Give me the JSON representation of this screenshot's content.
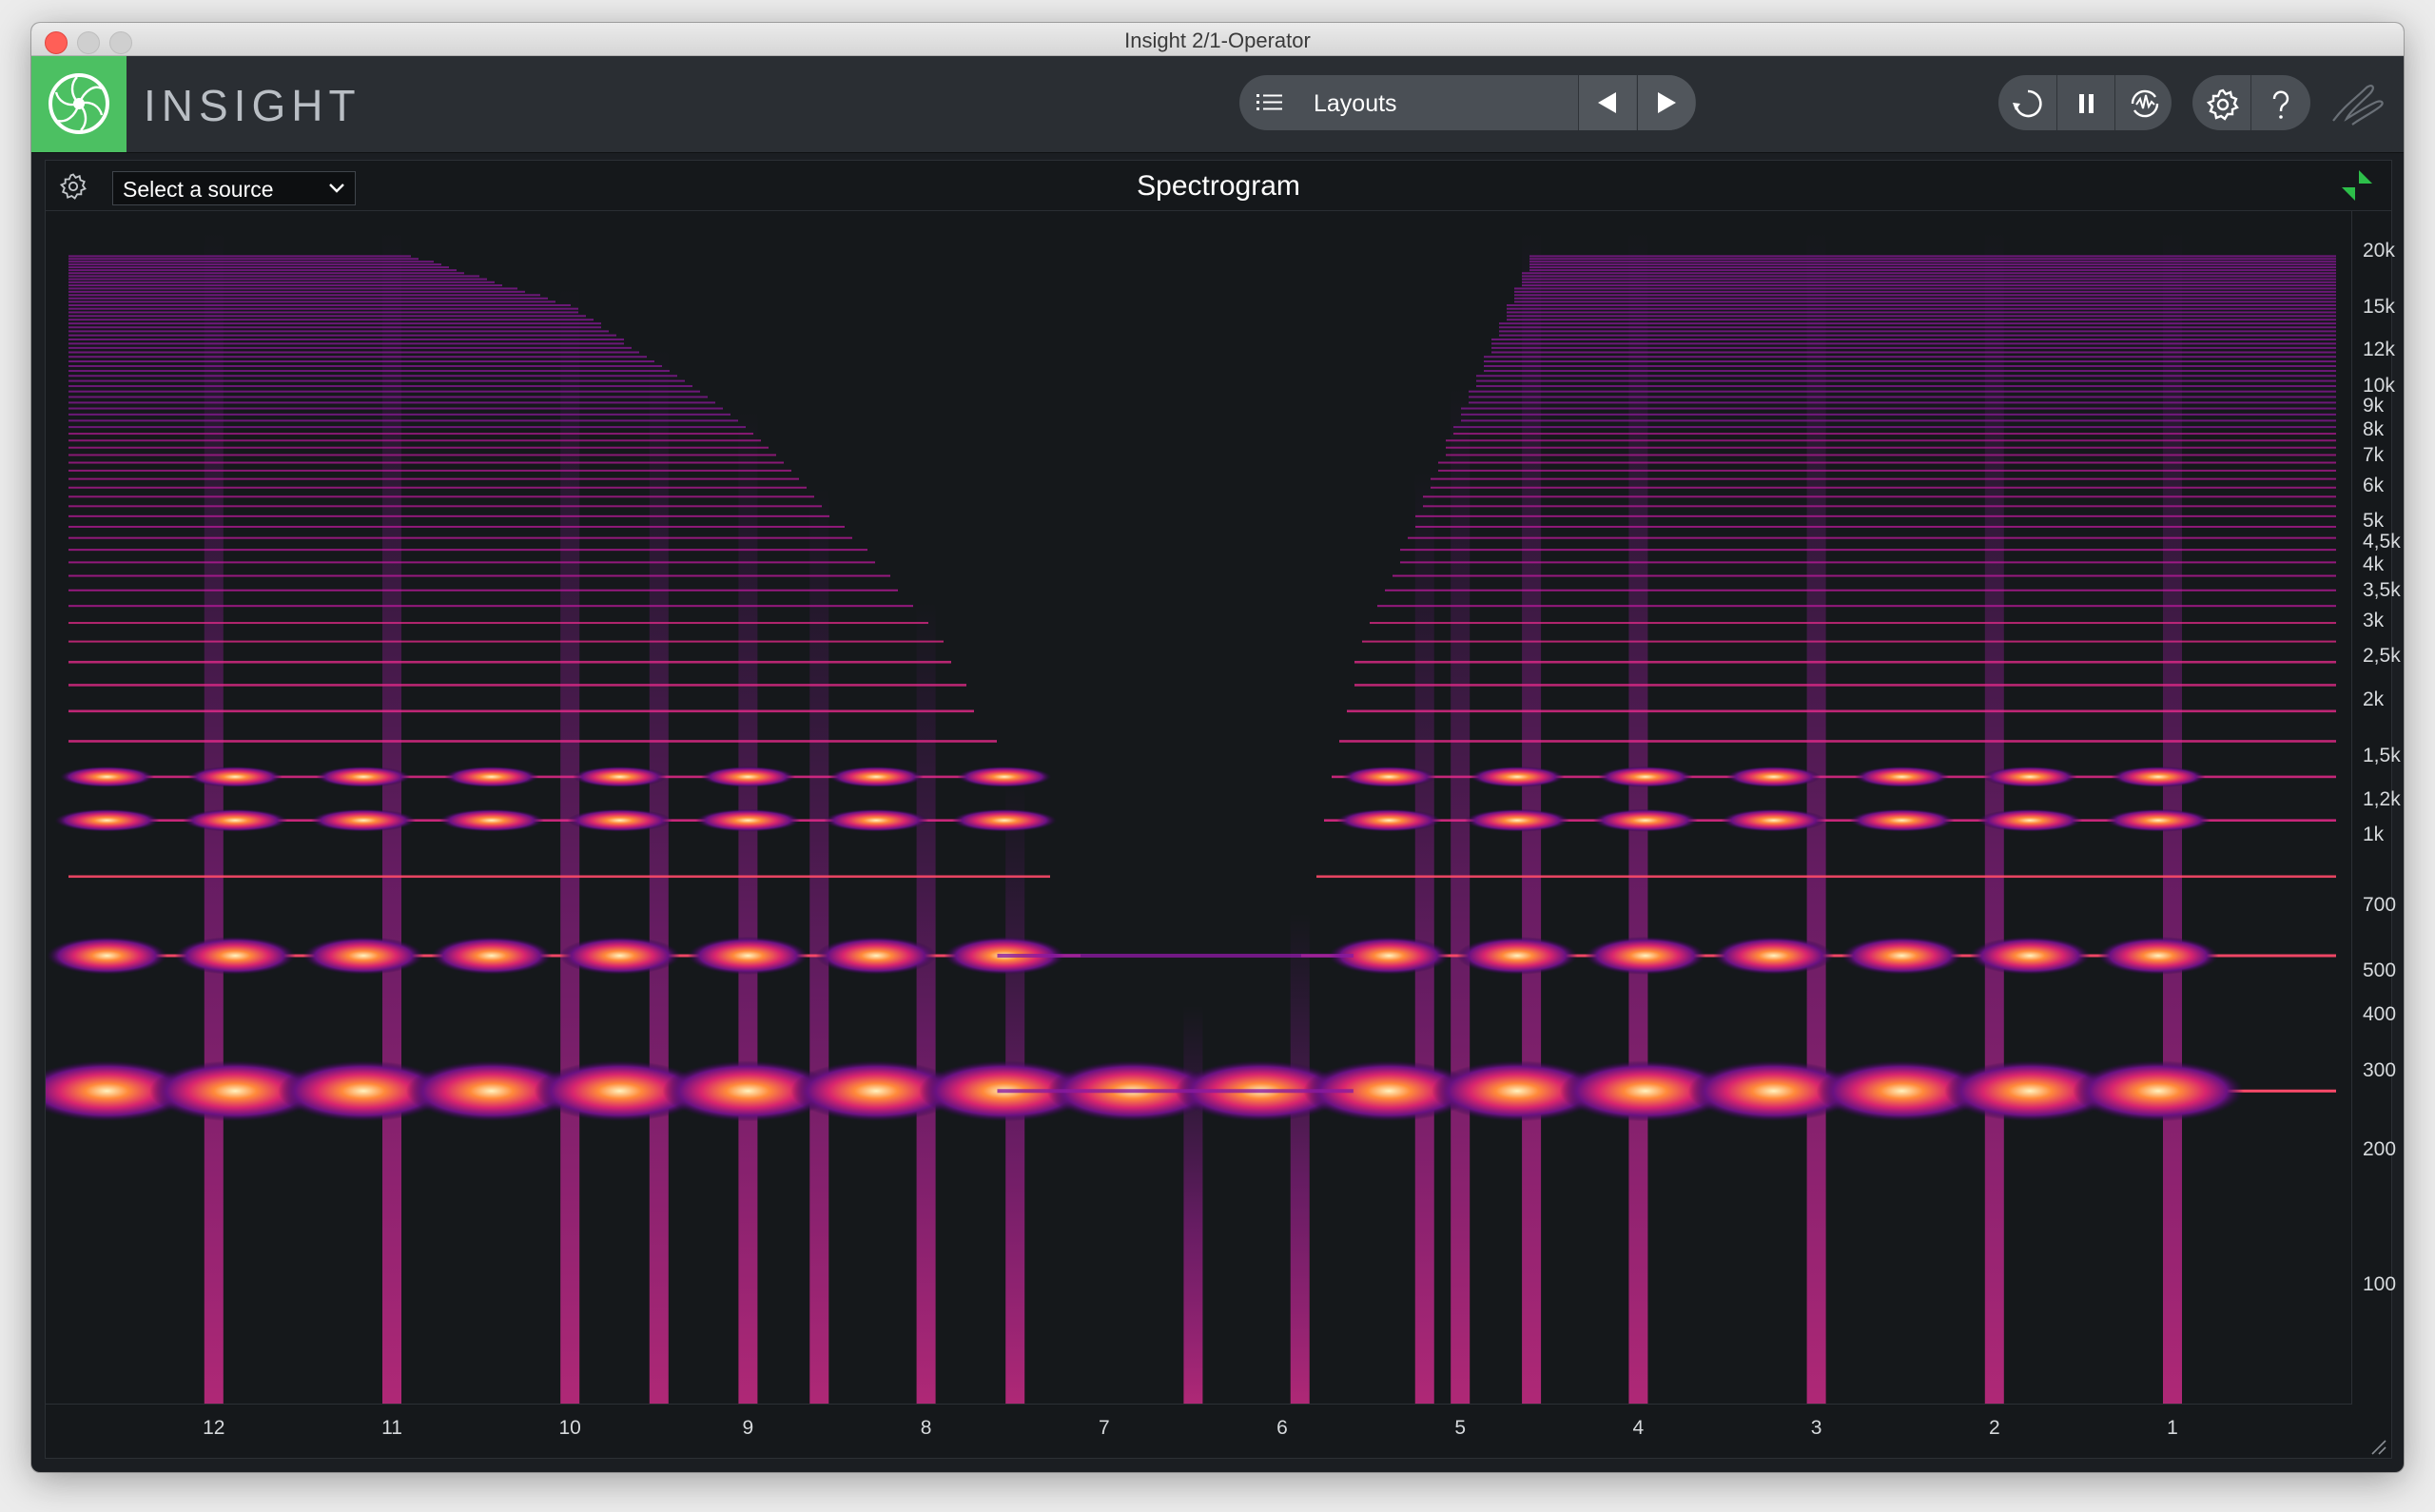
{
  "window": {
    "title": "Insight 2/1-Operator"
  },
  "toolbar": {
    "brand": "INSIGHT",
    "layouts_label": "Layouts",
    "colors": {
      "logo_green": "#4cc062",
      "toolbar_bg": "#2a2e33"
    }
  },
  "icons": {
    "logo": "izotope-logo-icon",
    "menu": "list-menu-icon",
    "prev": "triangle-left-icon",
    "next": "triangle-right-icon",
    "reset": "reset-icon",
    "pause": "pause-icon",
    "freeze": "freeze-icon",
    "settings": "gear-icon",
    "help": "question-icon",
    "brand_mark": "signature-icon"
  },
  "panel": {
    "source_select": "Select a source",
    "title": "Spectrogram"
  },
  "chart_data": {
    "type": "heatmap",
    "title": "Spectrogram",
    "y_ticks": [
      "20k",
      "15k",
      "12k",
      "10k",
      "9k",
      "8k",
      "7k",
      "6k",
      "5k",
      "4,5k",
      "4k",
      "3,5k",
      "3k",
      "2,5k",
      "2k",
      "1,5k",
      "1,2k",
      "1k",
      "700",
      "500",
      "400",
      "300",
      "200",
      "100"
    ],
    "x_ticks": [
      "12",
      "11",
      "10",
      "9",
      "8",
      "7",
      "6",
      "5",
      "4",
      "3",
      "2",
      "1"
    ],
    "y_scale": "log",
    "y_range_hz": [
      60,
      22000
    ],
    "fundamental_hz": 270,
    "harmonic_count": 72,
    "colormap": [
      "#15181b",
      "#3a0a5a",
      "#9a1aa0",
      "#e0307a",
      "#ff7a3a",
      "#fff4c0"
    ],
    "time_bandwidth_limits": [
      {
        "x": 12.6,
        "max_hz": 22000
      },
      {
        "x": 11.0,
        "max_hz": 20000
      },
      {
        "x": 10.0,
        "max_hz": 15000
      },
      {
        "x": 9.0,
        "max_hz": 8000
      },
      {
        "x": 8.0,
        "max_hz": 3000
      },
      {
        "x": 7.6,
        "max_hz": 1500
      },
      {
        "x": 7.0,
        "max_hz": 380
      },
      {
        "x": 6.0,
        "max_hz": 380
      },
      {
        "x": 5.6,
        "max_hz": 2500
      },
      {
        "x": 5.0,
        "max_hz": 9000
      },
      {
        "x": 4.6,
        "max_hz": 20000
      },
      {
        "x": 0.0,
        "max_hz": 22000
      }
    ],
    "note_onsets_x": [
      12,
      11,
      10,
      9.5,
      9,
      8.6,
      8,
      7.5,
      6.5,
      5.9,
      5.2,
      5,
      4.6,
      4,
      3,
      2,
      1
    ]
  }
}
